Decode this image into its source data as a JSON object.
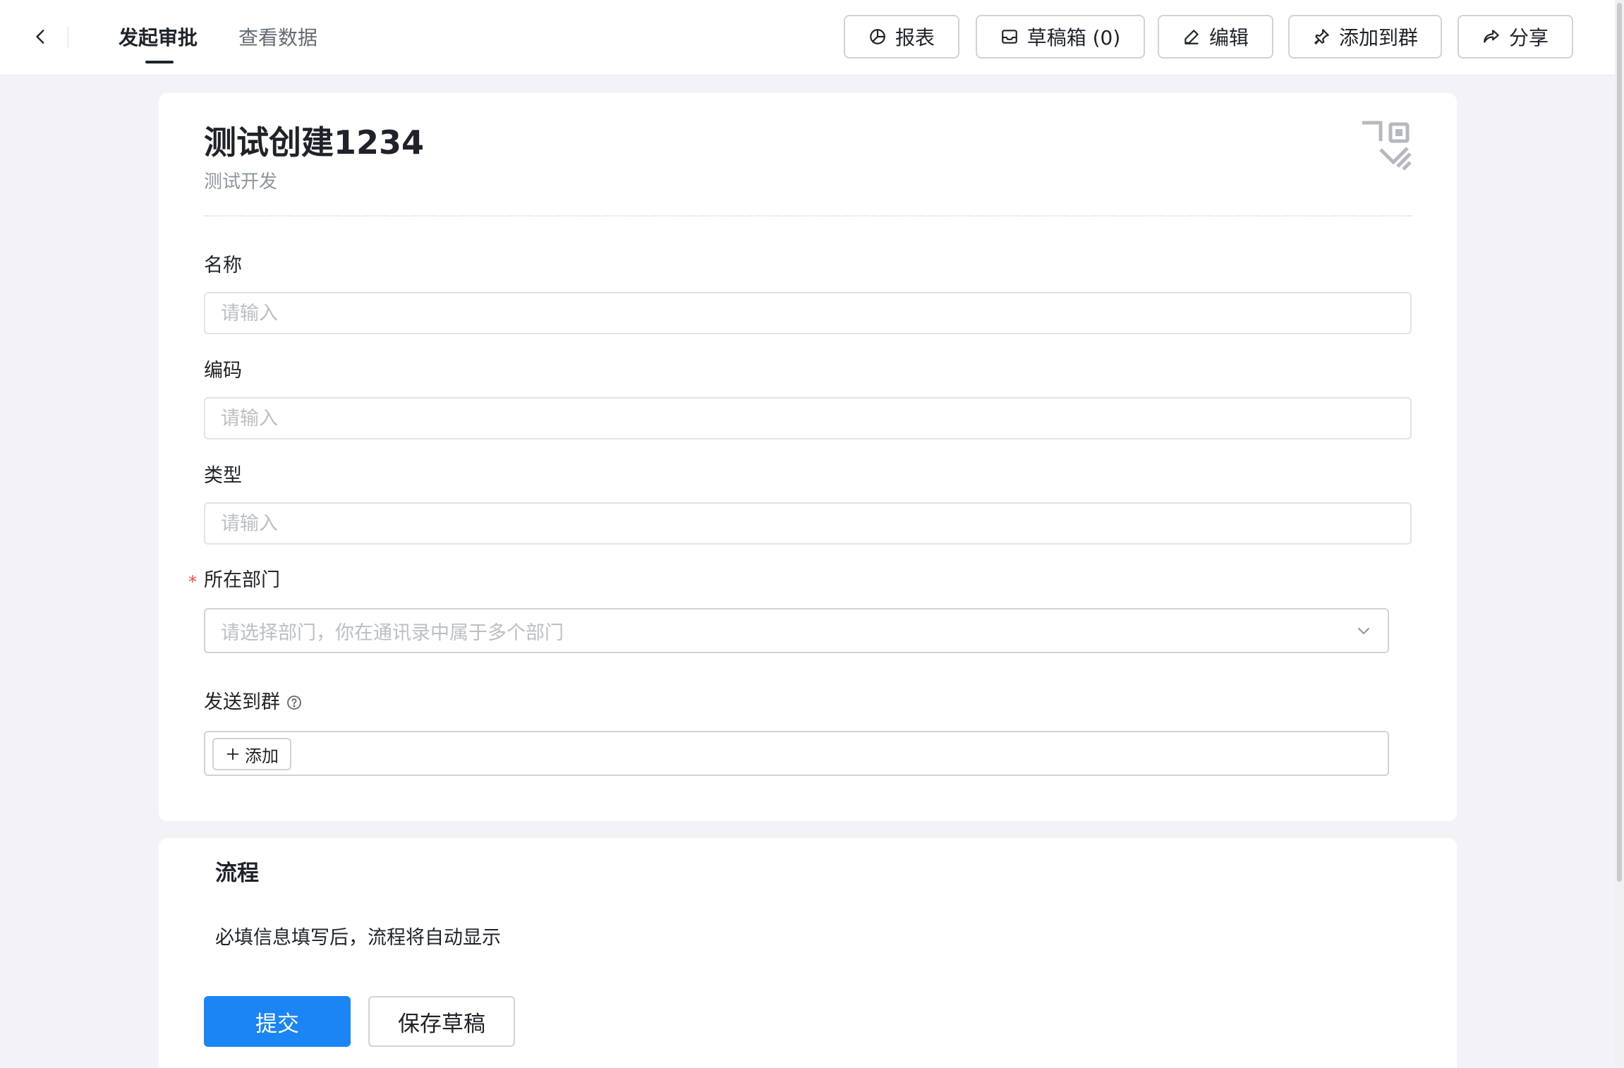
{
  "header": {
    "tabs": [
      {
        "label": "发起审批",
        "active": true
      },
      {
        "label": "查看数据",
        "active": false
      }
    ],
    "actions": {
      "report": "报表",
      "drafts": "草稿箱 (0)",
      "edit": "编辑",
      "add_to_group": "添加到群",
      "share": "分享"
    }
  },
  "form": {
    "title": "测试创建1234",
    "subtitle": "测试开发",
    "fields": {
      "name": {
        "label": "名称",
        "placeholder": "请输入",
        "value": ""
      },
      "code": {
        "label": "编码",
        "placeholder": "请输入",
        "value": ""
      },
      "type": {
        "label": "类型",
        "placeholder": "请输入",
        "value": ""
      },
      "department": {
        "label": "所在部门",
        "required_mark": "*",
        "placeholder": "请选择部门，你在通讯录中属于多个部门"
      },
      "send_to_group": {
        "label": "发送到群",
        "add_label": "添加"
      }
    }
  },
  "flow": {
    "title": "流程",
    "hint": "必填信息填写后，流程将自动显示",
    "submit_label": "提交",
    "save_draft_label": "保存草稿"
  },
  "colors": {
    "primary": "#1b85f5",
    "required": "#f54a45",
    "page_background": "#f3f3f7",
    "text_primary": "#1f2329",
    "text_secondary": "#646a73",
    "placeholder": "#bbbfc4"
  },
  "icons": [
    "chevron-left-icon",
    "pie-chart-icon",
    "inbox-icon",
    "pencil-icon",
    "pin-icon",
    "share-icon",
    "qr-code-icon",
    "chevron-down-icon",
    "question-circle-icon",
    "plus-icon"
  ]
}
